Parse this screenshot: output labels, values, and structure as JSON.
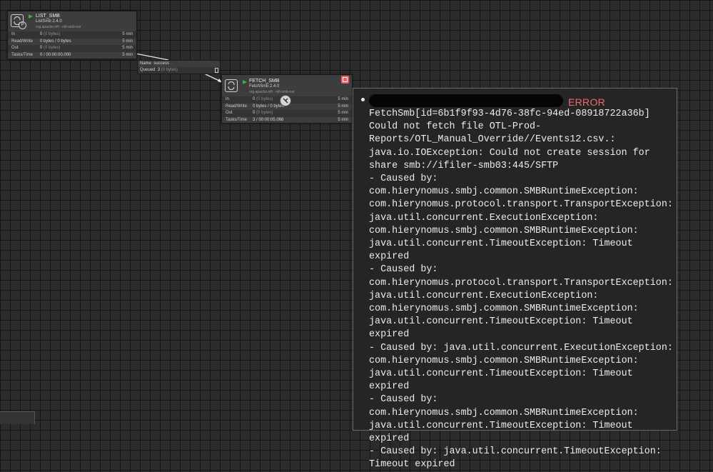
{
  "processors": [
    {
      "name": "LIST_SMB",
      "type": "ListSmb 2.4.0",
      "bundle": "org.apache.nifi - nifi-smb-nar",
      "badge": "P",
      "stats": [
        {
          "label": "In",
          "value": "0",
          "detail": "(0 bytes)",
          "time": "5 min"
        },
        {
          "label": "Read/Write",
          "value": "0 bytes / 0 bytes",
          "detail": "",
          "time": "5 min"
        },
        {
          "label": "Out",
          "value": "0",
          "detail": "(0 bytes)",
          "time": "5 min"
        },
        {
          "label": "Tasks/Time",
          "value": "0 / 00:00:00.000",
          "detail": "",
          "time": "5 min"
        }
      ]
    },
    {
      "name": "FETCH_SMB",
      "type": "FetchSmb 2.4.0",
      "bundle": "org.apache.nifi - nifi-smb-nar",
      "stats": [
        {
          "label": "In",
          "value": "0",
          "detail": "(0 bytes)",
          "time": "5 min"
        },
        {
          "label": "Read/Write",
          "value": "0 bytes / 0 bytes",
          "detail": "",
          "time": "5 min"
        },
        {
          "label": "Out",
          "value": "0",
          "detail": "(0 bytes)",
          "time": "5 min"
        },
        {
          "label": "Tasks/Time",
          "value": "3 / 00:00:05.068",
          "detail": "",
          "time": "5 min"
        }
      ]
    }
  ],
  "connection": {
    "name_label": "Name",
    "name_value": "success",
    "queued_label": "Queued",
    "queued_value": "3",
    "queued_detail": "(0 bytes)"
  },
  "bulletin": {
    "level": "ERROR",
    "message": "FetchSmb[id=6b1f9f93-4d76-38fc-94ed-08918722a36b] Could not fetch file OTL-Prod-Reports/OTL_Manual_Override//Events12.csv.: java.io.IOException: Could not create session for share smb://ifiler-smb03:445/SFTP\n- Caused by: com.hierynomus.smbj.common.SMBRuntimeException: com.hierynomus.protocol.transport.TransportException: java.util.concurrent.ExecutionException: com.hierynomus.smbj.common.SMBRuntimeException: java.util.concurrent.TimeoutException: Timeout expired\n- Caused by: com.hierynomus.protocol.transport.TransportException: java.util.concurrent.ExecutionException: com.hierynomus.smbj.common.SMBRuntimeException: java.util.concurrent.TimeoutException: Timeout expired\n- Caused by: java.util.concurrent.ExecutionException: com.hierynomus.smbj.common.SMBRuntimeException: java.util.concurrent.TimeoutException: Timeout expired\n- Caused by: com.hierynomus.smbj.common.SMBRuntimeException: java.util.concurrent.TimeoutException: Timeout expired\n- Caused by: java.util.concurrent.TimeoutException: Timeout expired"
  },
  "colors": {
    "canvas": "#2b2b2b",
    "running": "#3fae49",
    "error": "#ec5f64"
  },
  "icons": [
    "processor-icon",
    "primary-node-badge-icon",
    "run-status-icon",
    "bulletin-icon",
    "loading-cursor-icon"
  ]
}
